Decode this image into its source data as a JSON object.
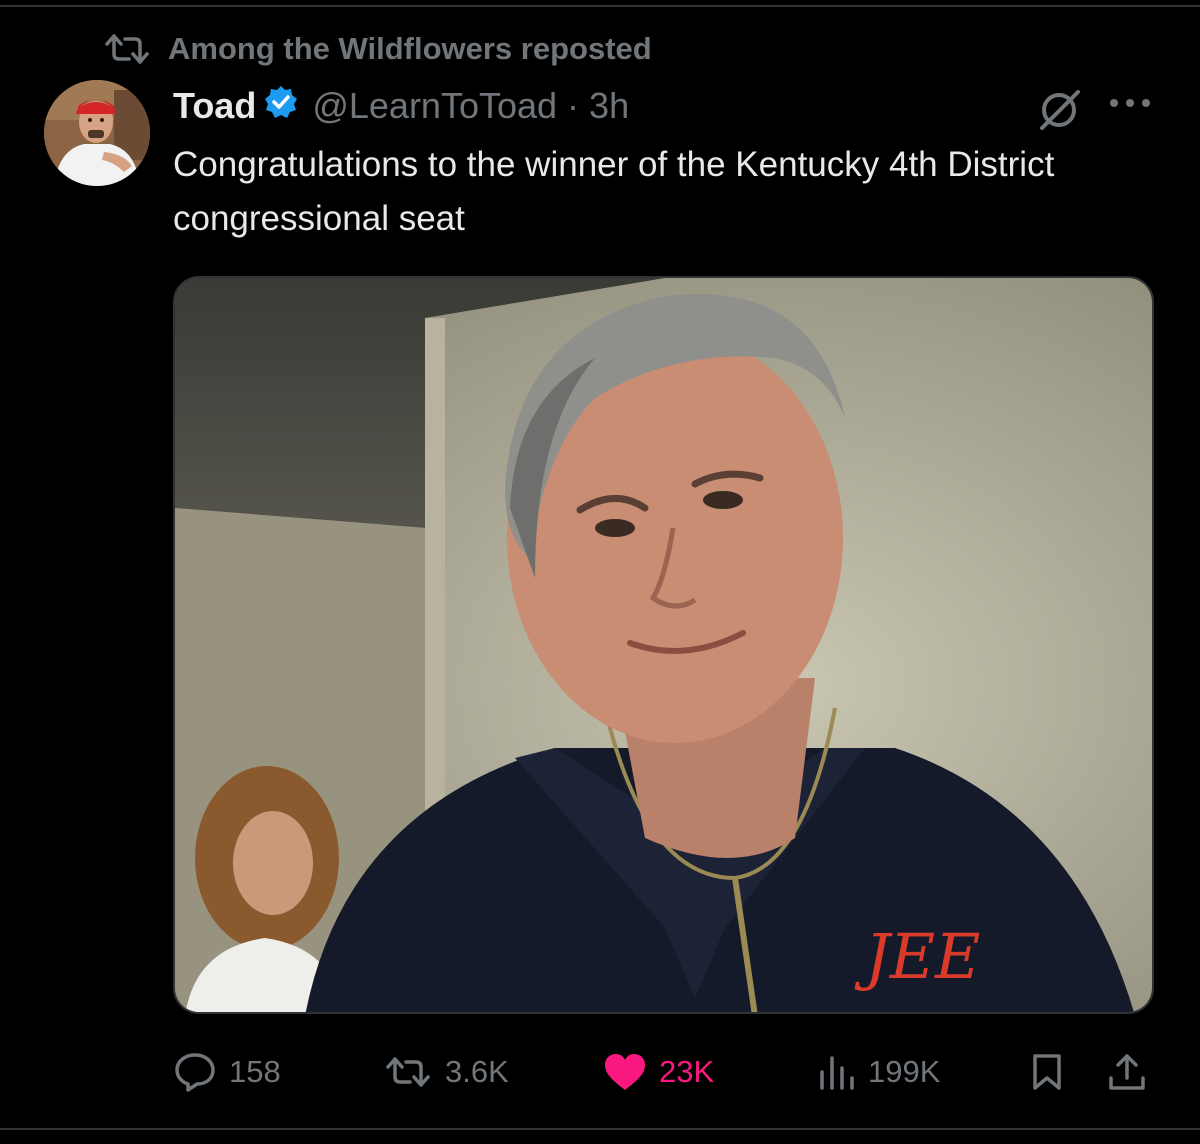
{
  "repost": {
    "text": "Among the Wildflowers reposted",
    "icon": "repost-icon"
  },
  "tweet": {
    "author": {
      "display_name": "Toad",
      "handle": "@LearnToToad",
      "verified": true
    },
    "separator": "·",
    "timestamp": "3h",
    "text": "Congratulations to the winner of the Kentucky 4th District congressional seat",
    "media": {
      "type": "photo"
    }
  },
  "actions": {
    "replies": "158",
    "reposts": "3.6K",
    "likes": "23K",
    "views": "199K",
    "liked": true
  },
  "colors": {
    "background": "#000000",
    "text_primary": "#e7e9ea",
    "text_secondary": "#71767b",
    "verified_blue": "#1d9bf0",
    "like_pink": "#f91880",
    "divider": "#2f3336"
  }
}
